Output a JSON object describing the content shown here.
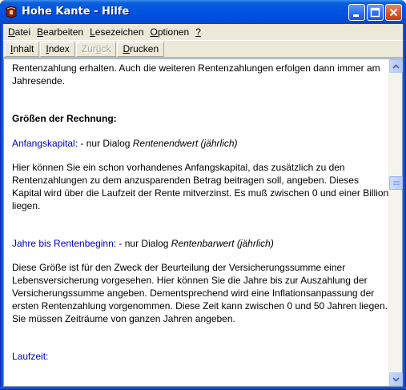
{
  "window": {
    "title": "Hohe Kante - Hilfe"
  },
  "menu": [
    {
      "pre": "",
      "u": "D",
      "post": "atei"
    },
    {
      "pre": "",
      "u": "B",
      "post": "earbeiten"
    },
    {
      "pre": "",
      "u": "L",
      "post": "esezeichen"
    },
    {
      "pre": "",
      "u": "O",
      "post": "ptionen"
    },
    {
      "pre": "",
      "u": "?",
      "post": ""
    }
  ],
  "toolbar": {
    "inhalt": {
      "u": "I",
      "post": "nhalt"
    },
    "index": {
      "u": "I",
      "post": "ndex"
    },
    "zurueck": {
      "pre": "Zur",
      "u": "ü",
      "post": "ck"
    },
    "drucken": {
      "u": "D",
      "post": "rucken"
    }
  },
  "content": {
    "intro": "Rentenzahlung erhalten. Auch die weiteren Rentenzahlungen erfolgen dann immer am Jahresende.",
    "heading": "Größen der Rechnung:",
    "s1": {
      "term": "Anfangskapital:",
      "sep": " - nur Dialog ",
      "dialog": "Rentenendwert (jährlich)",
      "text": "Hier können Sie ein schon vorhandenes Anfangskapital, das zusätzlich zu den Rentenzahlungen zu dem anzusparenden Betrag beitragen soll, angeben. Dieses Kapital wird über die Laufzeit der Rente mitverzinst. Es muß zwischen 0 und einer Billion liegen."
    },
    "s2": {
      "term": "Jahre bis Rentenbeginn:",
      "sep": " - nur Dialog ",
      "dialog": "Rentenbarwert (jährlich)",
      "text": "Diese Größe ist für den Zweck der Beurteilung der Versicherungssumme einer Lebensversicherung vorgesehen. Hier können Sie die Jahre bis zur Auszahlung der Versicherungssumme angeben. Dementsprechend wird eine Inflationsanpassung der ersten Rentenzahlung vorgenommen. Diese Zeit kann zwischen 0 und 50 Jahren liegen. Sie müssen Zeiträume von ganzen Jahren angeben."
    },
    "s3": {
      "term": "Laufzeit:"
    }
  },
  "scrollbar": {
    "position": 0.36
  },
  "colors": {
    "link": "#0000cc",
    "titlebar": "#0054e3",
    "close": "#d8522c"
  }
}
